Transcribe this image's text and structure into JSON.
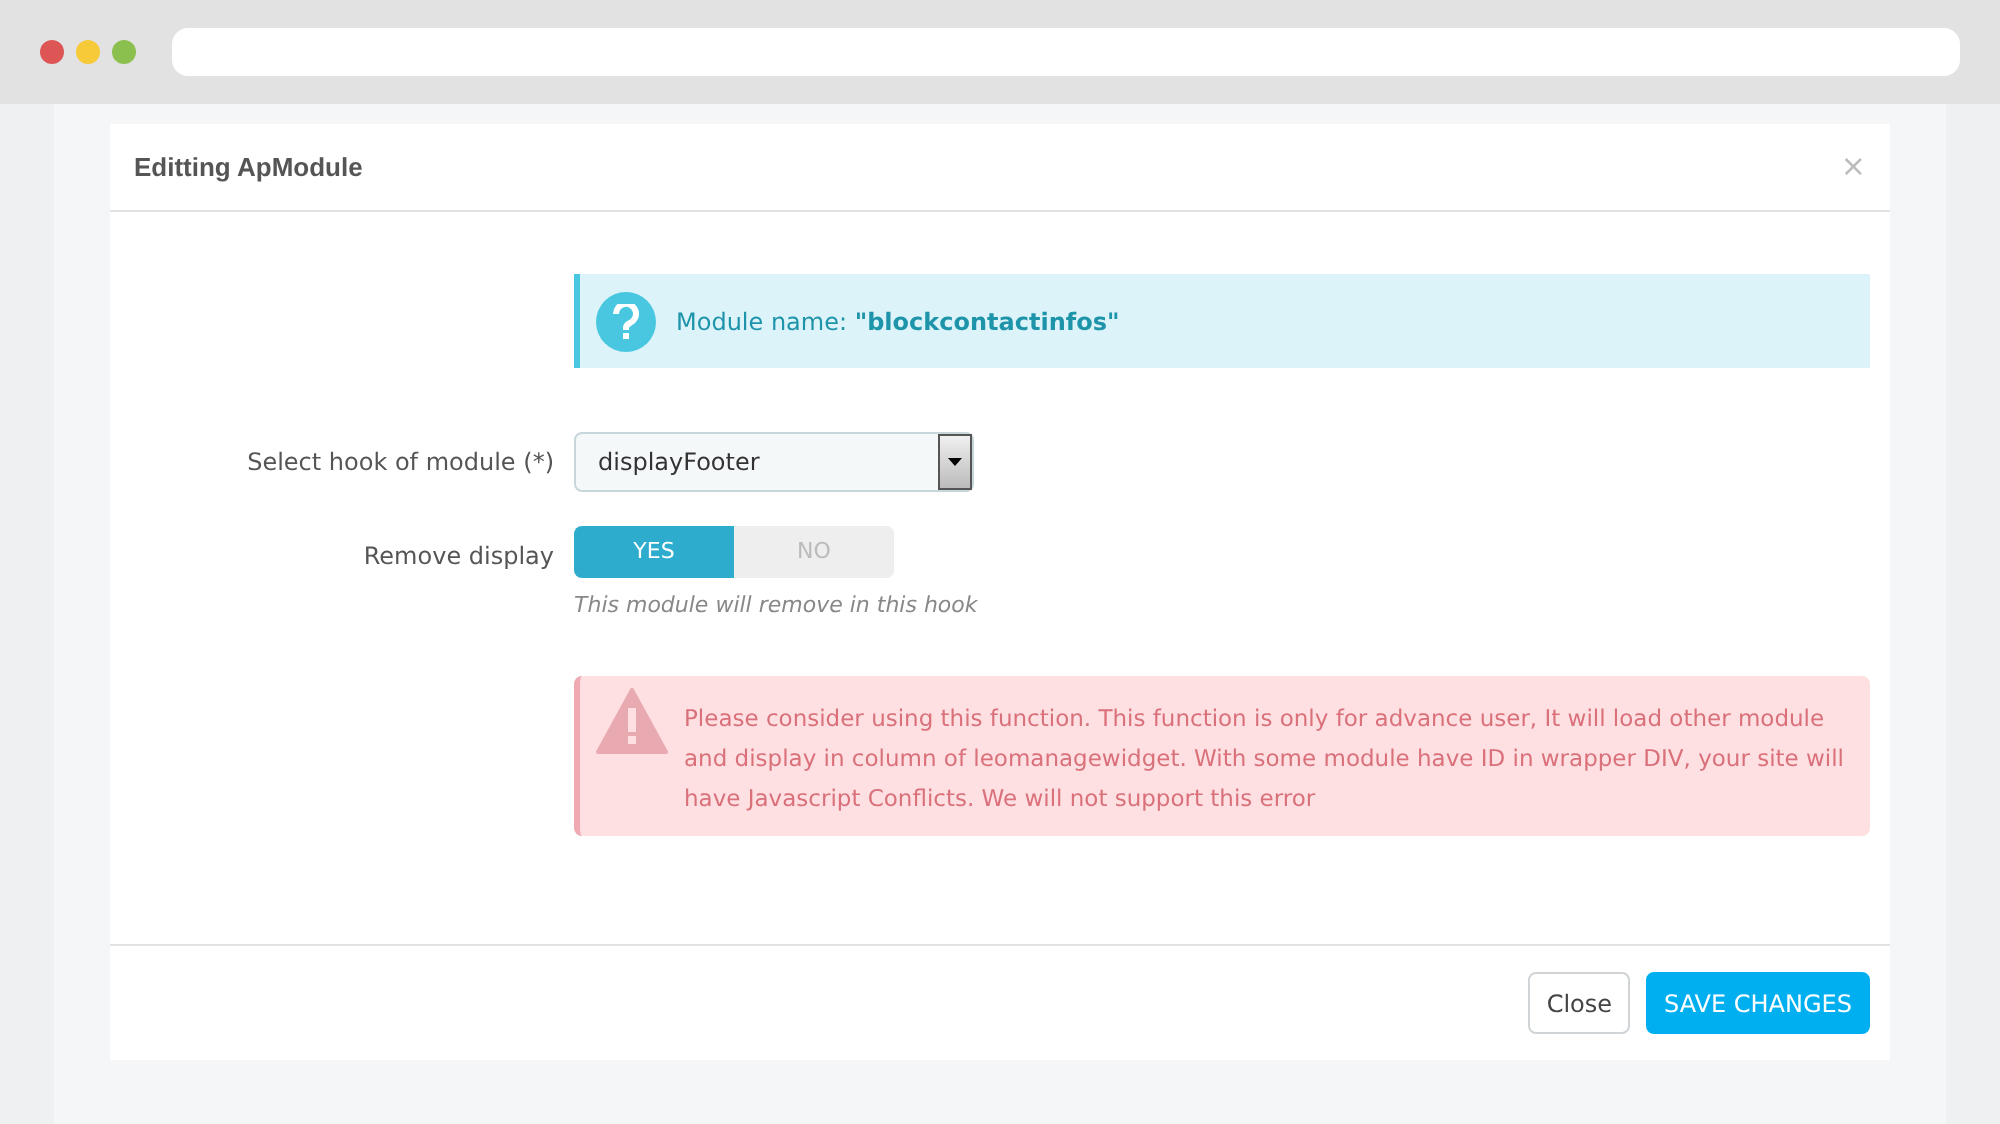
{
  "modal": {
    "title": "Editting ApModule",
    "close_icon": "×"
  },
  "info": {
    "text": "Module name: **\"blockcontactinfos\"**"
  },
  "hook": {
    "label": "Select hook of module (*)",
    "value": "displayFooter"
  },
  "remove_display": {
    "label": "Remove display",
    "options": [
      {
        "label": "YES",
        "selected": true
      },
      {
        "label": "NO",
        "selected": false
      }
    ],
    "help": "This module will remove in this hook"
  },
  "warning": {
    "text": "Please consider using this function. This function is only for advance user, It will load other module and display in column of leomanagewidget. With some module have ID in wrapper DIV, your site will have Javascript Conflicts. We will not support this error"
  },
  "buttons": [
    {
      "label": "Close",
      "kind": "secondary"
    },
    {
      "label": "SAVE CHANGES",
      "kind": "primary"
    }
  ]
}
